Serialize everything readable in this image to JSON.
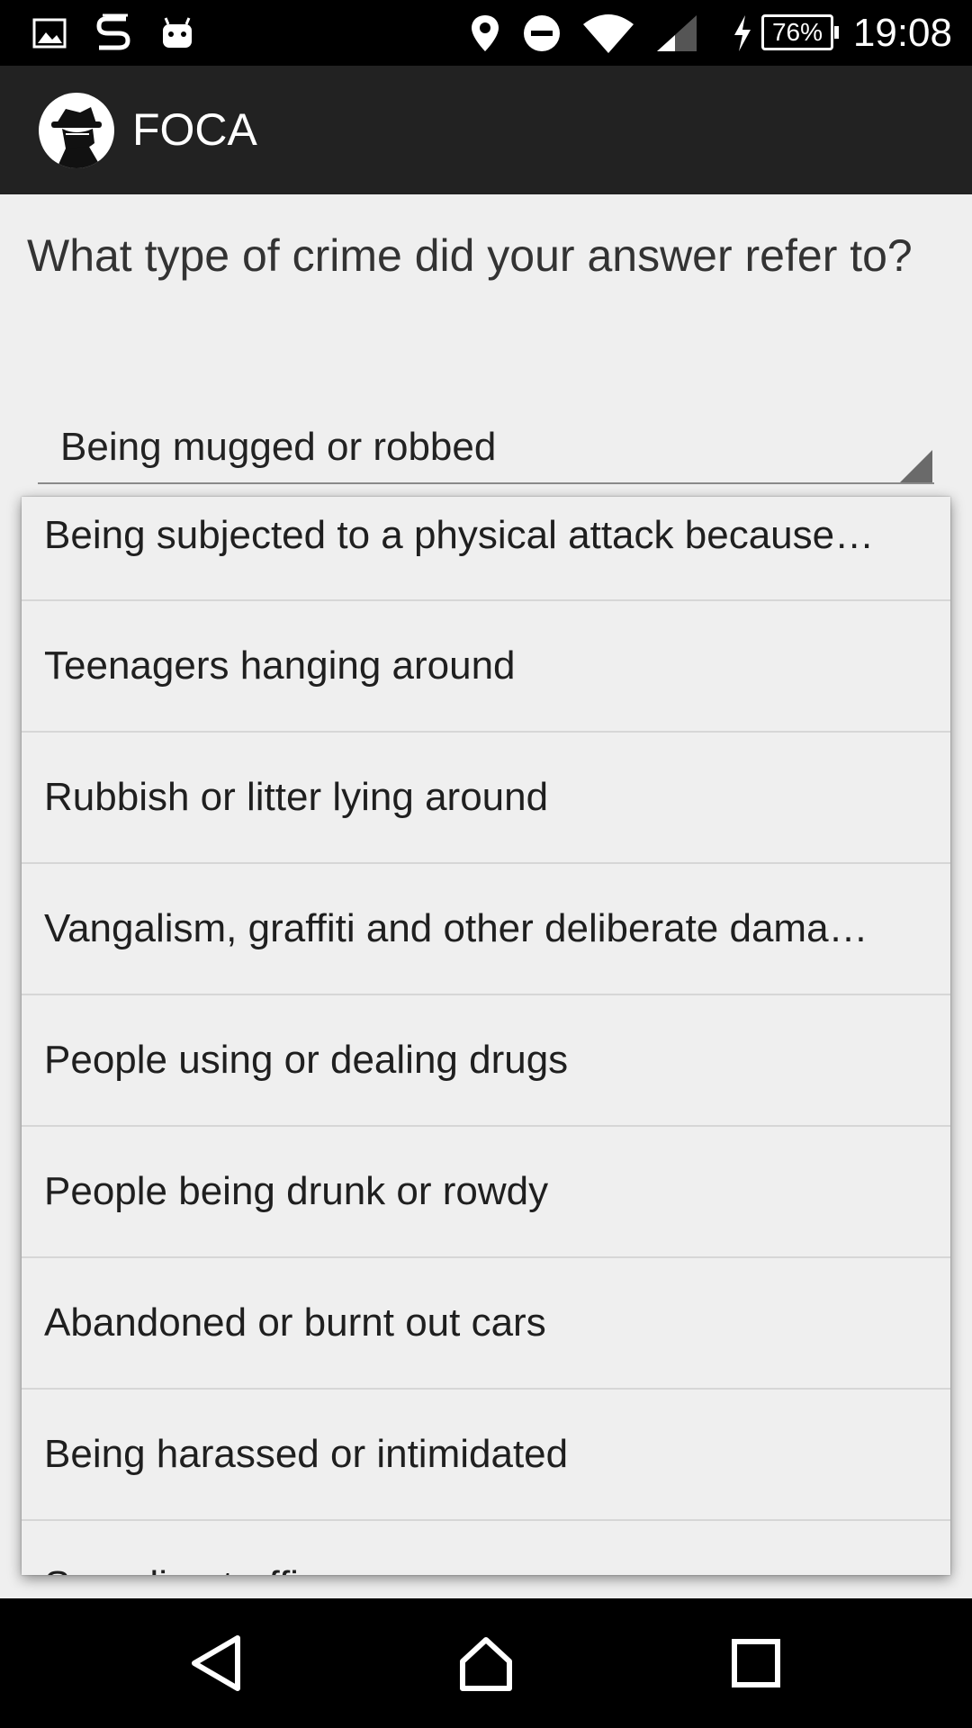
{
  "status_bar": {
    "time": "19:08",
    "battery": "76%",
    "icons": [
      "gallery-icon",
      "s-app-icon",
      "android-icon",
      "location-icon",
      "do-not-disturb-icon",
      "wifi-icon",
      "signal-icon",
      "charging-icon",
      "battery-icon"
    ]
  },
  "app_bar": {
    "title": "FOCA",
    "logo": "spy-logo-icon"
  },
  "question": "What type of crime did your answer refer to?",
  "spinner": {
    "selected": "Being mugged or robbed"
  },
  "dropdown": {
    "items": [
      "Being subjected to a physical attack because…",
      "Teenagers hanging around",
      "Rubbish or litter lying around",
      "Vangalism, graffiti and other deliberate dama…",
      "People using or dealing drugs",
      "People being drunk or rowdy",
      "Abandoned or burnt out cars",
      "Being harassed or intimidated",
      "Speeding traffic"
    ]
  },
  "nav_bar": {
    "buttons": [
      "back-icon",
      "home-icon",
      "recents-icon"
    ]
  }
}
